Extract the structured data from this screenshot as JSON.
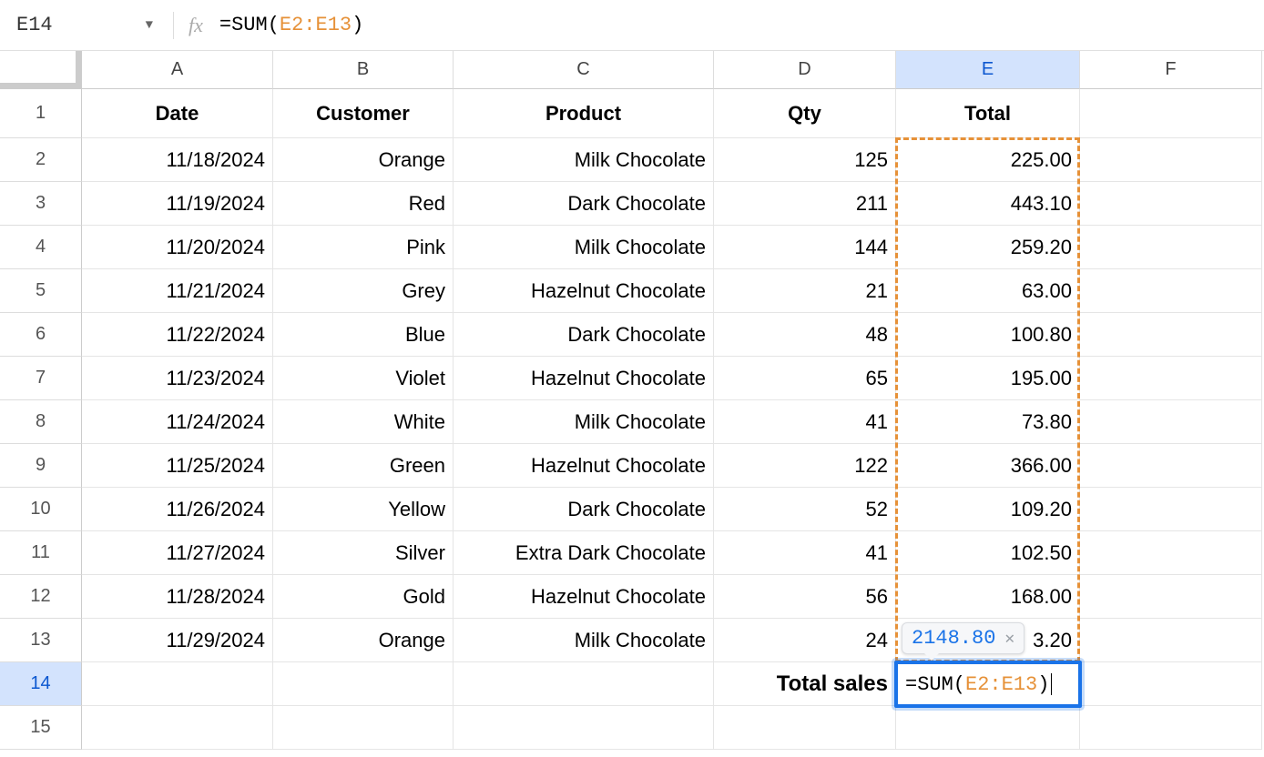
{
  "cell_ref": "E14",
  "formula": {
    "prefix": "=SUM(",
    "range": "E2:E13",
    "suffix": ")"
  },
  "result_hint": "2148.80",
  "cols": [
    "A",
    "B",
    "C",
    "D",
    "E",
    "F"
  ],
  "selected_col": "E",
  "selected_row": "14",
  "headers": {
    "A": "Date",
    "B": "Customer",
    "C": "Product",
    "D": "Qty",
    "E": "Total"
  },
  "rows": [
    {
      "n": "2",
      "date": "11/18/2024",
      "cust": "Orange",
      "prod": "Milk Chocolate",
      "qty": "125",
      "tot": "225.00"
    },
    {
      "n": "3",
      "date": "11/19/2024",
      "cust": "Red",
      "prod": "Dark Chocolate",
      "qty": "211",
      "tot": "443.10"
    },
    {
      "n": "4",
      "date": "11/20/2024",
      "cust": "Pink",
      "prod": "Milk Chocolate",
      "qty": "144",
      "tot": "259.20"
    },
    {
      "n": "5",
      "date": "11/21/2024",
      "cust": "Grey",
      "prod": "Hazelnut Chocolate",
      "qty": "21",
      "tot": "63.00"
    },
    {
      "n": "6",
      "date": "11/22/2024",
      "cust": "Blue",
      "prod": "Dark Chocolate",
      "qty": "48",
      "tot": "100.80"
    },
    {
      "n": "7",
      "date": "11/23/2024",
      "cust": "Violet",
      "prod": "Hazelnut Chocolate",
      "qty": "65",
      "tot": "195.00"
    },
    {
      "n": "8",
      "date": "11/24/2024",
      "cust": "White",
      "prod": "Milk Chocolate",
      "qty": "41",
      "tot": "73.80"
    },
    {
      "n": "9",
      "date": "11/25/2024",
      "cust": "Green",
      "prod": "Hazelnut Chocolate",
      "qty": "122",
      "tot": "366.00"
    },
    {
      "n": "10",
      "date": "11/26/2024",
      "cust": "Yellow",
      "prod": "Dark Chocolate",
      "qty": "52",
      "tot": "109.20"
    },
    {
      "n": "11",
      "date": "11/27/2024",
      "cust": "Silver",
      "prod": "Extra Dark Chocolate",
      "qty": "41",
      "tot": "102.50"
    },
    {
      "n": "12",
      "date": "11/28/2024",
      "cust": "Gold",
      "prod": "Hazelnut Chocolate",
      "qty": "56",
      "tot": "168.00"
    },
    {
      "n": "13",
      "date": "11/29/2024",
      "cust": "Orange",
      "prod": "Milk Chocolate",
      "qty": "24",
      "tot": "3.20"
    }
  ],
  "total_sales_label": "Total sales",
  "trailing_rows": [
    "14",
    "15"
  ]
}
